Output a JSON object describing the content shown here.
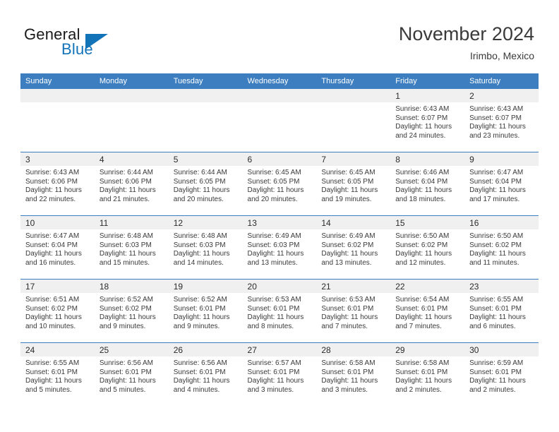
{
  "brand": {
    "name_primary": "General",
    "name_secondary": "Blue",
    "triangle_icon": "blue-triangle-icon",
    "accent_color": "#1273b8"
  },
  "header": {
    "title": "November 2024",
    "subtitle": "Irimbo, Mexico"
  },
  "colors": {
    "header_row_bg": "#3c7ebf",
    "daynum_band_bg": "#f0f0f0",
    "grid_line": "#3c7ebf",
    "text": "#3a3a3a"
  },
  "labels": {
    "sunrise_prefix": "Sunrise:",
    "sunset_prefix": "Sunset:",
    "daylight_prefix": "Daylight:"
  },
  "weekdays": [
    "Sunday",
    "Monday",
    "Tuesday",
    "Wednesday",
    "Thursday",
    "Friday",
    "Saturday"
  ],
  "weeks": [
    [
      {
        "empty": true
      },
      {
        "empty": true
      },
      {
        "empty": true
      },
      {
        "empty": true
      },
      {
        "empty": true
      },
      {
        "day": "1",
        "sunrise": "Sunrise: 6:43 AM",
        "sunset": "Sunset: 6:07 PM",
        "daylight": "Daylight: 11 hours and 24 minutes."
      },
      {
        "day": "2",
        "sunrise": "Sunrise: 6:43 AM",
        "sunset": "Sunset: 6:07 PM",
        "daylight": "Daylight: 11 hours and 23 minutes."
      }
    ],
    [
      {
        "day": "3",
        "sunrise": "Sunrise: 6:43 AM",
        "sunset": "Sunset: 6:06 PM",
        "daylight": "Daylight: 11 hours and 22 minutes."
      },
      {
        "day": "4",
        "sunrise": "Sunrise: 6:44 AM",
        "sunset": "Sunset: 6:06 PM",
        "daylight": "Daylight: 11 hours and 21 minutes."
      },
      {
        "day": "5",
        "sunrise": "Sunrise: 6:44 AM",
        "sunset": "Sunset: 6:05 PM",
        "daylight": "Daylight: 11 hours and 20 minutes."
      },
      {
        "day": "6",
        "sunrise": "Sunrise: 6:45 AM",
        "sunset": "Sunset: 6:05 PM",
        "daylight": "Daylight: 11 hours and 20 minutes."
      },
      {
        "day": "7",
        "sunrise": "Sunrise: 6:45 AM",
        "sunset": "Sunset: 6:05 PM",
        "daylight": "Daylight: 11 hours and 19 minutes."
      },
      {
        "day": "8",
        "sunrise": "Sunrise: 6:46 AM",
        "sunset": "Sunset: 6:04 PM",
        "daylight": "Daylight: 11 hours and 18 minutes."
      },
      {
        "day": "9",
        "sunrise": "Sunrise: 6:47 AM",
        "sunset": "Sunset: 6:04 PM",
        "daylight": "Daylight: 11 hours and 17 minutes."
      }
    ],
    [
      {
        "day": "10",
        "sunrise": "Sunrise: 6:47 AM",
        "sunset": "Sunset: 6:04 PM",
        "daylight": "Daylight: 11 hours and 16 minutes."
      },
      {
        "day": "11",
        "sunrise": "Sunrise: 6:48 AM",
        "sunset": "Sunset: 6:03 PM",
        "daylight": "Daylight: 11 hours and 15 minutes."
      },
      {
        "day": "12",
        "sunrise": "Sunrise: 6:48 AM",
        "sunset": "Sunset: 6:03 PM",
        "daylight": "Daylight: 11 hours and 14 minutes."
      },
      {
        "day": "13",
        "sunrise": "Sunrise: 6:49 AM",
        "sunset": "Sunset: 6:03 PM",
        "daylight": "Daylight: 11 hours and 13 minutes."
      },
      {
        "day": "14",
        "sunrise": "Sunrise: 6:49 AM",
        "sunset": "Sunset: 6:02 PM",
        "daylight": "Daylight: 11 hours and 13 minutes."
      },
      {
        "day": "15",
        "sunrise": "Sunrise: 6:50 AM",
        "sunset": "Sunset: 6:02 PM",
        "daylight": "Daylight: 11 hours and 12 minutes."
      },
      {
        "day": "16",
        "sunrise": "Sunrise: 6:50 AM",
        "sunset": "Sunset: 6:02 PM",
        "daylight": "Daylight: 11 hours and 11 minutes."
      }
    ],
    [
      {
        "day": "17",
        "sunrise": "Sunrise: 6:51 AM",
        "sunset": "Sunset: 6:02 PM",
        "daylight": "Daylight: 11 hours and 10 minutes."
      },
      {
        "day": "18",
        "sunrise": "Sunrise: 6:52 AM",
        "sunset": "Sunset: 6:02 PM",
        "daylight": "Daylight: 11 hours and 9 minutes."
      },
      {
        "day": "19",
        "sunrise": "Sunrise: 6:52 AM",
        "sunset": "Sunset: 6:01 PM",
        "daylight": "Daylight: 11 hours and 9 minutes."
      },
      {
        "day": "20",
        "sunrise": "Sunrise: 6:53 AM",
        "sunset": "Sunset: 6:01 PM",
        "daylight": "Daylight: 11 hours and 8 minutes."
      },
      {
        "day": "21",
        "sunrise": "Sunrise: 6:53 AM",
        "sunset": "Sunset: 6:01 PM",
        "daylight": "Daylight: 11 hours and 7 minutes."
      },
      {
        "day": "22",
        "sunrise": "Sunrise: 6:54 AM",
        "sunset": "Sunset: 6:01 PM",
        "daylight": "Daylight: 11 hours and 7 minutes."
      },
      {
        "day": "23",
        "sunrise": "Sunrise: 6:55 AM",
        "sunset": "Sunset: 6:01 PM",
        "daylight": "Daylight: 11 hours and 6 minutes."
      }
    ],
    [
      {
        "day": "24",
        "sunrise": "Sunrise: 6:55 AM",
        "sunset": "Sunset: 6:01 PM",
        "daylight": "Daylight: 11 hours and 5 minutes."
      },
      {
        "day": "25",
        "sunrise": "Sunrise: 6:56 AM",
        "sunset": "Sunset: 6:01 PM",
        "daylight": "Daylight: 11 hours and 5 minutes."
      },
      {
        "day": "26",
        "sunrise": "Sunrise: 6:56 AM",
        "sunset": "Sunset: 6:01 PM",
        "daylight": "Daylight: 11 hours and 4 minutes."
      },
      {
        "day": "27",
        "sunrise": "Sunrise: 6:57 AM",
        "sunset": "Sunset: 6:01 PM",
        "daylight": "Daylight: 11 hours and 3 minutes."
      },
      {
        "day": "28",
        "sunrise": "Sunrise: 6:58 AM",
        "sunset": "Sunset: 6:01 PM",
        "daylight": "Daylight: 11 hours and 3 minutes."
      },
      {
        "day": "29",
        "sunrise": "Sunrise: 6:58 AM",
        "sunset": "Sunset: 6:01 PM",
        "daylight": "Daylight: 11 hours and 2 minutes."
      },
      {
        "day": "30",
        "sunrise": "Sunrise: 6:59 AM",
        "sunset": "Sunset: 6:01 PM",
        "daylight": "Daylight: 11 hours and 2 minutes."
      }
    ]
  ]
}
